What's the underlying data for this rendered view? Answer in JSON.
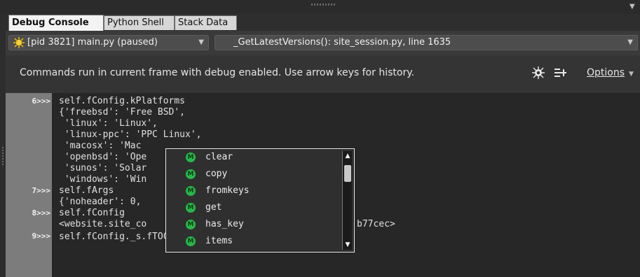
{
  "tabs": [
    {
      "label": "Debug Console",
      "active": true
    },
    {
      "label": "Python Shell",
      "active": false
    },
    {
      "label": "Stack Data",
      "active": false
    }
  ],
  "process_select": {
    "value": "[pid 3821] main.py (paused)",
    "icon": "bug-icon"
  },
  "frame_select": {
    "value": "_GetLatestVersions(): site_session.py, line 1635"
  },
  "info": {
    "message": "Commands run in current frame with debug enabled.  Use arrow keys for history.",
    "options_label": "Options",
    "tools": [
      "debug-bug-icon",
      "list-add-icon"
    ]
  },
  "console": {
    "lines": [
      {
        "prompt": "6>>>",
        "text": "self.fConfig.kPlatforms"
      },
      {
        "prompt": "",
        "text": "{'freebsd': 'Free BSD',"
      },
      {
        "prompt": "",
        "text": " 'linux': 'Linux',"
      },
      {
        "prompt": "",
        "text": " 'linux-ppc': 'PPC Linux',"
      },
      {
        "prompt": "",
        "text": " 'macosx': 'Mac"
      },
      {
        "prompt": "",
        "text": " 'openbsd': 'Ope"
      },
      {
        "prompt": "",
        "text": " 'sunos': 'Solar"
      },
      {
        "prompt": "",
        "text": " 'windows': 'Win"
      },
      {
        "prompt": "7>>>",
        "text": "self.fArgs"
      },
      {
        "prompt": "",
        "text": "{'noheader': 0,"
      },
      {
        "prompt": "8>>>",
        "text": "self.fConfig"
      },
      {
        "prompt": "",
        "text": "<website.site_co"
      },
      {
        "prompt": "9>>>",
        "text": "self.fConfig._s.fTOCs."
      }
    ],
    "overflow_text": "b77cec>"
  },
  "autocomplete": {
    "badge": "M",
    "items": [
      "clear",
      "copy",
      "fromkeys",
      "get",
      "has_key",
      "items"
    ]
  },
  "colors": {
    "accent_green": "#27b64a",
    "console_bg": "#272727",
    "gutter": "#7c7c7c"
  }
}
